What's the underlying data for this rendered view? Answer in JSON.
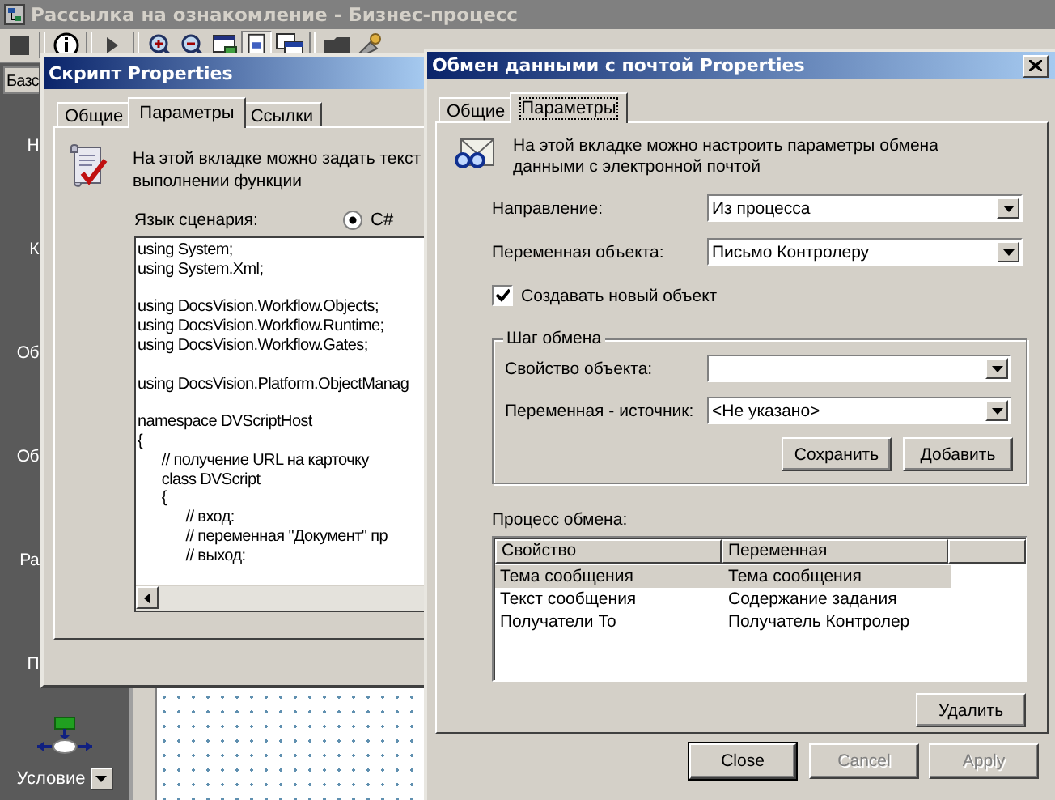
{
  "app_window": {
    "title": "Рассылка на ознакомление - Бизнес-процесс",
    "left_panel": {
      "tab": "Базс",
      "labels": [
        "Н",
        "К",
        "Об",
        "Об",
        "Ра",
        "П"
      ],
      "condition_label": "Условие"
    }
  },
  "script_window": {
    "title": "Скрипт Properties",
    "tabs": [
      {
        "label": "Общие",
        "selected": false
      },
      {
        "label": "Параметры",
        "selected": true
      },
      {
        "label": "Ссылки",
        "selected": false
      }
    ],
    "description_lines": [
      "На этой вкладке можно задать текст",
      "выполнении функции"
    ],
    "language_label": "Язык сценария:",
    "language_option": {
      "label": "C#",
      "selected": true
    },
    "code_blocks": [
      [
        "using System;",
        "using System.Xml;"
      ],
      [
        "using DocsVision.Workflow.Objects;",
        "using DocsVision.Workflow.Runtime;",
        "using DocsVision.Workflow.Gates;"
      ],
      [
        "using DocsVision.Platform.ObjectManag"
      ],
      [
        "namespace DVScriptHost",
        "{",
        "      // получение URL на карточку",
        "      class DVScript",
        "      {",
        "            // вход:",
        "            // переменная \"Документ\" пр",
        "            // выход:"
      ]
    ]
  },
  "mail_window": {
    "title": "Обмен данными с почтой Properties",
    "tabs": [
      {
        "label": "Общие",
        "selected": false
      },
      {
        "label": "Параметры",
        "selected": true
      }
    ],
    "description": "На этой вкладке можно настроить параметры обмена данными с электронной почтой",
    "fields": [
      {
        "label": "Направление:",
        "value": "Из процесса"
      },
      {
        "label": "Переменная объекта:",
        "value": "Письмо Контролеру"
      }
    ],
    "create_new": {
      "label": "Создавать новый объект",
      "checked": true
    },
    "step_group": {
      "title": "Шаг обмена",
      "fields": [
        {
          "label": "Свойство объекта:"
        },
        {
          "label": "Переменная - источник:",
          "value": "<Не указано>"
        }
      ],
      "buttons": [
        "Сохранить",
        "Добавить"
      ]
    },
    "process_label": "Процесс обмена:",
    "table": {
      "columns": [
        "Свойство",
        "Переменная"
      ],
      "rows": [
        {
          "cells": [
            "Тема сообщения",
            "Тема сообщения"
          ],
          "selected": true
        },
        {
          "cells": [
            "Текст сообщения",
            "Содержание задания"
          ],
          "selected": false
        },
        {
          "cells": [
            "Получатели To",
            "Получатель Контролер"
          ],
          "selected": false
        }
      ]
    },
    "delete_button": "Удалить",
    "dialog_buttons": [
      {
        "label": "Close",
        "disabled": false,
        "default": true
      },
      {
        "label": "Cancel",
        "disabled": true,
        "default": false
      },
      {
        "label": "Apply",
        "disabled": true,
        "default": false
      }
    ]
  }
}
